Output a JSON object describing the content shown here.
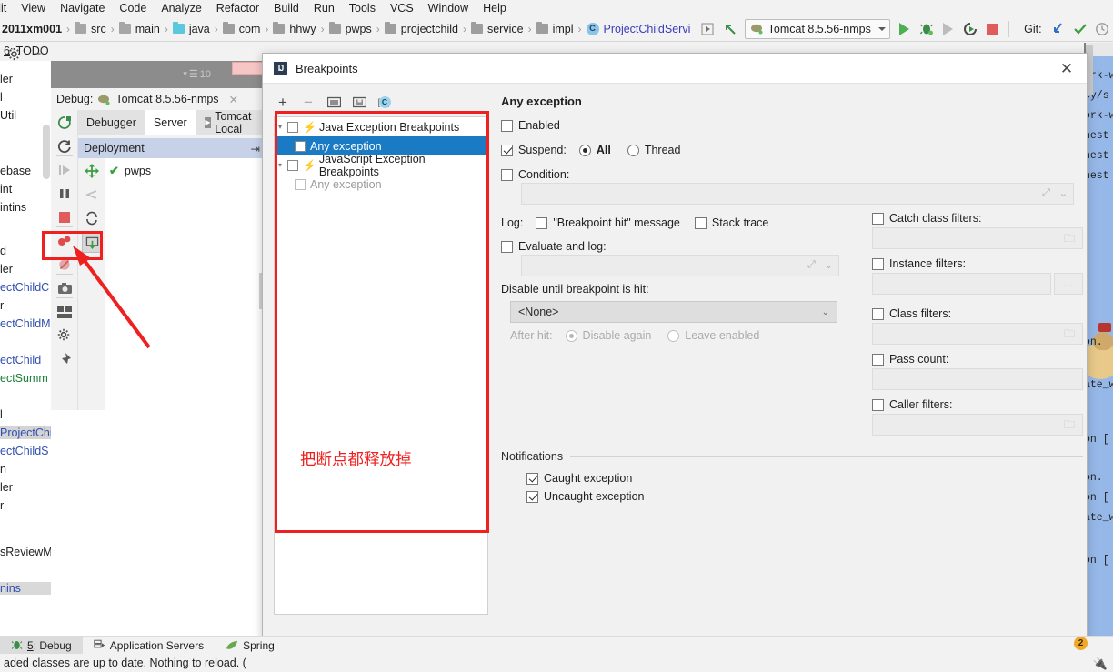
{
  "menubar": {
    "items": [
      "dit",
      "View",
      "Navigate",
      "Code",
      "Analyze",
      "Refactor",
      "Build",
      "Run",
      "Tools",
      "VCS",
      "Window",
      "Help"
    ]
  },
  "navbar": {
    "breadcrumbs": [
      {
        "label": "2011xm001",
        "type": "project"
      },
      {
        "label": "src",
        "type": "folder"
      },
      {
        "label": "main",
        "type": "folder"
      },
      {
        "label": "java",
        "type": "source-folder"
      },
      {
        "label": "com",
        "type": "package"
      },
      {
        "label": "hhwy",
        "type": "package"
      },
      {
        "label": "pwps",
        "type": "package"
      },
      {
        "label": "projectchild",
        "type": "package"
      },
      {
        "label": "service",
        "type": "package"
      },
      {
        "label": "impl",
        "type": "package"
      },
      {
        "label": "ProjectChildServi",
        "type": "class"
      }
    ],
    "run_configuration": "Tomcat 8.5.56-nmps",
    "git_label": "Git:"
  },
  "left_tool_tab": {
    "number": "6",
    "label": ": TODO"
  },
  "project_tree_fragments": [
    "ler",
    "l",
    "Util",
    "ebase",
    "int",
    "intins",
    "d",
    "ler",
    "ectChildC",
    "r",
    "ectChildM",
    "ectChild",
    "ectSumm",
    "l",
    "ProjectChi",
    "ectChildS",
    "n",
    "ler",
    "r",
    "sReviewM",
    "nins"
  ],
  "debug_window": {
    "count_badge": "10",
    "title_prefix": "Debug:",
    "session_name": "Tomcat 8.5.56-nmps",
    "tabs": [
      "Debugger",
      "Server",
      "Tomcat Local"
    ],
    "deployment_header": "Deployment",
    "deployment_item": "pwps"
  },
  "dialog": {
    "title": "Breakpoints",
    "close_label": "✕",
    "toolbar": {
      "add": "+",
      "remove": "−",
      "group_by_file": "group-by-file",
      "group_by_package": "group-by-package",
      "group_by_class": "C"
    },
    "tree": [
      {
        "label": "Java Exception Breakpoints",
        "checked": false,
        "level": 0,
        "selected": false,
        "bolt": true,
        "dim": false
      },
      {
        "label": "Any exception",
        "checked": false,
        "level": 1,
        "selected": true,
        "bolt": false,
        "dim": false
      },
      {
        "label": "JavaScript Exception Breakpoints",
        "checked": false,
        "level": 0,
        "selected": false,
        "bolt": true,
        "dim": false
      },
      {
        "label": "Any exception",
        "checked": false,
        "level": 1,
        "selected": false,
        "bolt": false,
        "dim": true
      }
    ],
    "annotation_cn": "把断点都释放掉",
    "detail": {
      "heading": "Any exception",
      "enabled": {
        "label": "Enabled",
        "checked": false
      },
      "suspend": {
        "label": "Suspend:",
        "checked": true,
        "options": [
          "All",
          "Thread"
        ],
        "selected": "All"
      },
      "condition": {
        "label": "Condition:",
        "checked": false,
        "value": ""
      },
      "log": {
        "label": "Log:",
        "breakpoint_hit": {
          "label": "\"Breakpoint hit\" message",
          "checked": false
        },
        "stack_trace": {
          "label": "Stack trace",
          "checked": false
        }
      },
      "evaluate_and_log": {
        "label": "Evaluate and log:",
        "checked": false,
        "value": ""
      },
      "disable_until": {
        "label": "Disable until breakpoint is hit:",
        "value": "<None>",
        "after_hit_label": "After hit:",
        "after_hit_options": [
          "Disable again",
          "Leave enabled"
        ],
        "after_hit_selected": "Disable again"
      },
      "filters": [
        {
          "label": "Catch class filters:",
          "checked": false,
          "value": "",
          "button": "folder"
        },
        {
          "label": "Instance filters:",
          "checked": false,
          "value": "",
          "button": "dots"
        },
        {
          "label": "Class filters:",
          "checked": false,
          "value": "",
          "button": "folder"
        },
        {
          "label": "Pass count:",
          "checked": false,
          "value": "",
          "button": "none"
        },
        {
          "label": "Caller filters:",
          "checked": false,
          "value": "",
          "button": "folder"
        }
      ],
      "notifications": {
        "title": "Notifications",
        "caught": {
          "label": "Caught exception",
          "checked": true
        },
        "uncaught": {
          "label": "Uncaught exception",
          "checked": true
        }
      }
    }
  },
  "editor_fragments": [
    "ork-w",
    "cy/s",
    "ork-w",
    "nest",
    "nest",
    "nest",
    "on.",
    "ate_w",
    "on [",
    "on. ",
    "on [",
    "ate_w",
    "on ["
  ],
  "toolwindow_bar": {
    "items": [
      {
        "number": "5",
        "label": ": Debug",
        "active": true,
        "icon": "debug-icon"
      },
      {
        "number": "",
        "label": "Application Servers",
        "active": false,
        "icon": "server-icon"
      },
      {
        "number": "",
        "label": "Spring",
        "active": false,
        "icon": "spring-leaf-icon"
      }
    ]
  },
  "statusbar": {
    "message": "aded classes are up to date. Nothing to reload. (",
    "warning_count": "2"
  },
  "colors": {
    "accent_blue": "#1a7bc4",
    "annotation_red": "#ef2020",
    "green_run": "#4caf50",
    "stop_red": "#e05c5c",
    "folder_cyan": "#5bc8dd"
  }
}
